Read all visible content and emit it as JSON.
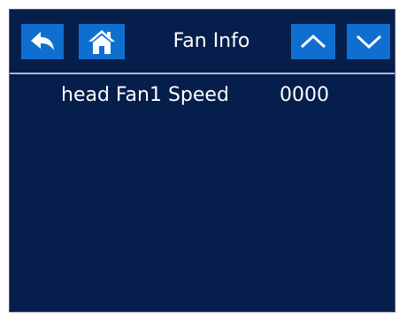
{
  "header": {
    "title": "Fan Info",
    "buttons": {
      "back_icon": "back-arrow-icon",
      "home_icon": "home-icon",
      "up_icon": "chevron-up-icon",
      "down_icon": "chevron-down-icon"
    }
  },
  "fan_list": [
    {
      "label": "head Fan1 Speed",
      "value": "0000"
    }
  ],
  "colors": {
    "background": "#061e4b",
    "button": "#0f6fd0",
    "text": "#ffffff",
    "divider": "#a9b7cf"
  }
}
